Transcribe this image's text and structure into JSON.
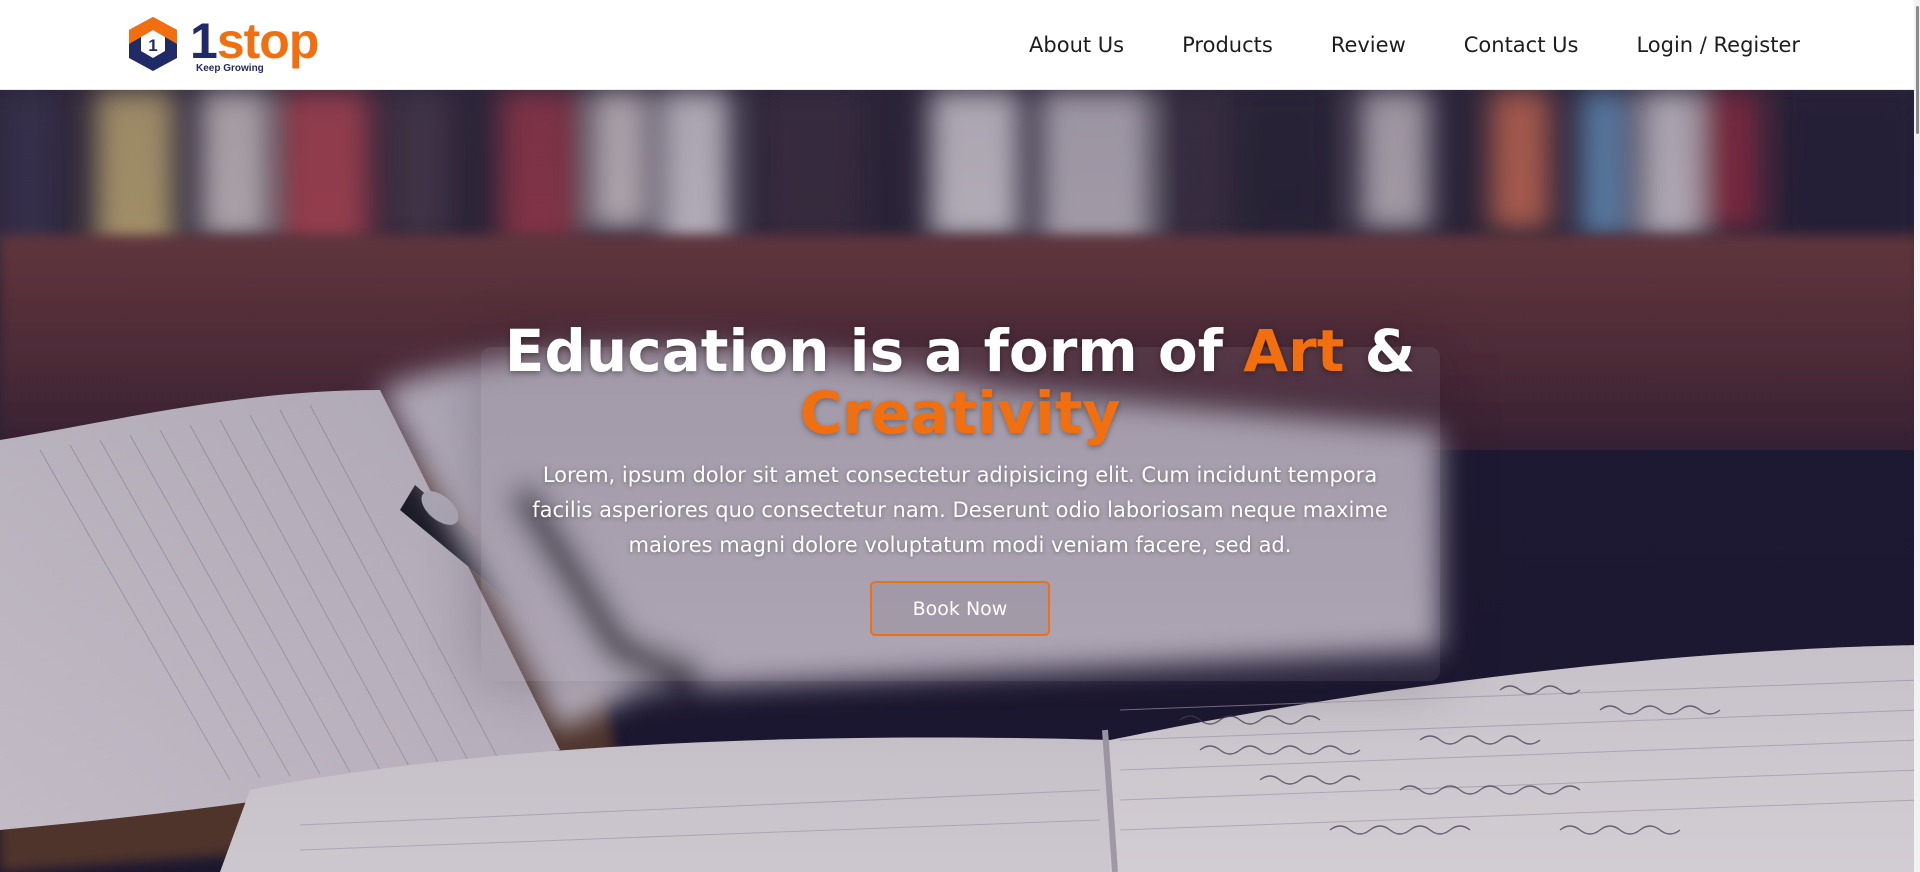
{
  "brand": {
    "digit": "1",
    "wordmark": "stop",
    "tagline": "Keep Growing",
    "orange": "#f26f10",
    "navy": "#1f2a66"
  },
  "nav": {
    "items": [
      {
        "label": "About Us"
      },
      {
        "label": "Products"
      },
      {
        "label": "Review"
      },
      {
        "label": "Contact Us"
      },
      {
        "label": "Login / Register"
      }
    ]
  },
  "hero": {
    "title_part1": "Education is a form of ",
    "title_accent1": "Art",
    "title_part2": " &",
    "title_accent2": "Creativity",
    "description": "Lorem, ipsum dolor sit amet consectetur adipisicing elit. Cum incidunt tempora facilis asperiores quo consectetur nam. Deserunt odio laboriosam neque maxime maiores magni dolore voluptatum modi veniam facere, sed ad.",
    "cta_label": "Book Now",
    "accent_color": "#f26f10"
  },
  "icons": {
    "logo": "hexagon-logo-icon"
  }
}
